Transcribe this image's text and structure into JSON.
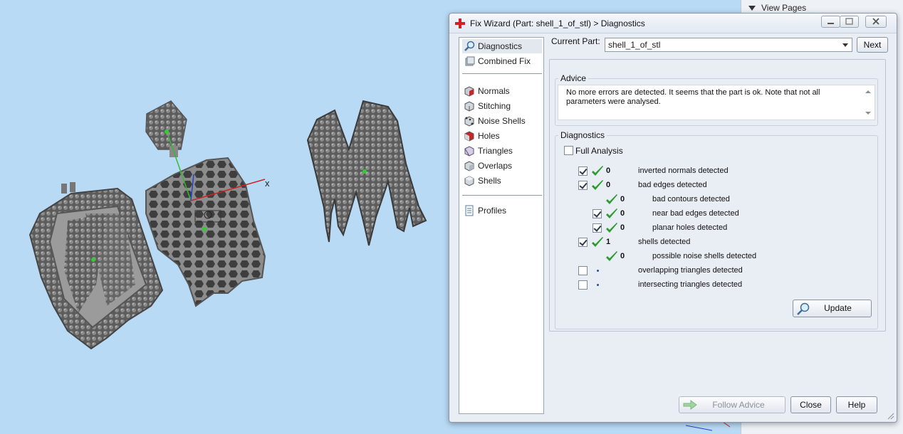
{
  "dialog": {
    "title": "Fix Wizard (Part: shell_1_of_stl) > Diagnostics",
    "current_part_label": "Current Part:",
    "current_part_value": "shell_1_of_stl",
    "next_label": "Next",
    "advice_legend": "Advice",
    "advice_text": "No more errors are detected. It seems that the part is ok. Note that not all parameters were analysed.",
    "diagnostics_legend": "Diagnostics",
    "full_analysis_label": "Full Analysis",
    "update_label": "Update",
    "follow_advice_label": "Follow Advice",
    "close_label": "Close",
    "help_label": "Help"
  },
  "nav": {
    "items": [
      {
        "label": "Diagnostics",
        "icon": "magnifier-icon"
      },
      {
        "label": "Combined Fix",
        "icon": "combined-fix-icon"
      },
      {
        "label": "Normals",
        "icon": "normals-cube-icon"
      },
      {
        "label": "Stitching",
        "icon": "stitching-cube-icon"
      },
      {
        "label": "Noise Shells",
        "icon": "noise-shells-icon"
      },
      {
        "label": "Holes",
        "icon": "holes-cube-icon"
      },
      {
        "label": "Triangles",
        "icon": "triangles-cube-icon"
      },
      {
        "label": "Overlaps",
        "icon": "overlaps-cube-icon"
      },
      {
        "label": "Shells",
        "icon": "shells-cube-icon"
      },
      {
        "label": "Profiles",
        "icon": "profiles-document-icon"
      }
    ]
  },
  "diagnostics": [
    {
      "checked": true,
      "status": "ok",
      "count": "0",
      "label": "inverted normals detected",
      "indent": 0
    },
    {
      "checked": true,
      "status": "ok",
      "count": "0",
      "label": "bad edges detected",
      "indent": 0
    },
    {
      "checked": null,
      "status": "ok",
      "count": "0",
      "label": "bad contours detected",
      "indent": 1
    },
    {
      "checked": true,
      "status": "ok",
      "count": "0",
      "label": "near bad edges detected",
      "indent": 1
    },
    {
      "checked": true,
      "status": "ok",
      "count": "0",
      "label": "planar holes detected",
      "indent": 1
    },
    {
      "checked": true,
      "status": "ok",
      "count": "1",
      "label": "shells detected",
      "indent": 0
    },
    {
      "checked": null,
      "status": "ok",
      "count": "0",
      "label": "possible noise shells detected",
      "indent": 1
    },
    {
      "checked": false,
      "status": "pending",
      "count": "",
      "label": "overlapping triangles detected",
      "indent": 0
    },
    {
      "checked": false,
      "status": "pending",
      "count": "",
      "label": "intersecting triangles detected",
      "indent": 0
    }
  ],
  "viewport": {
    "axis_label": "x"
  },
  "side_panel": {
    "header": "View Pages"
  },
  "colors": {
    "viewport_bg": "#b9daf5",
    "check_green": "#2e9b2e",
    "axis_red": "#cc2222",
    "axis_green": "#33bb33"
  }
}
